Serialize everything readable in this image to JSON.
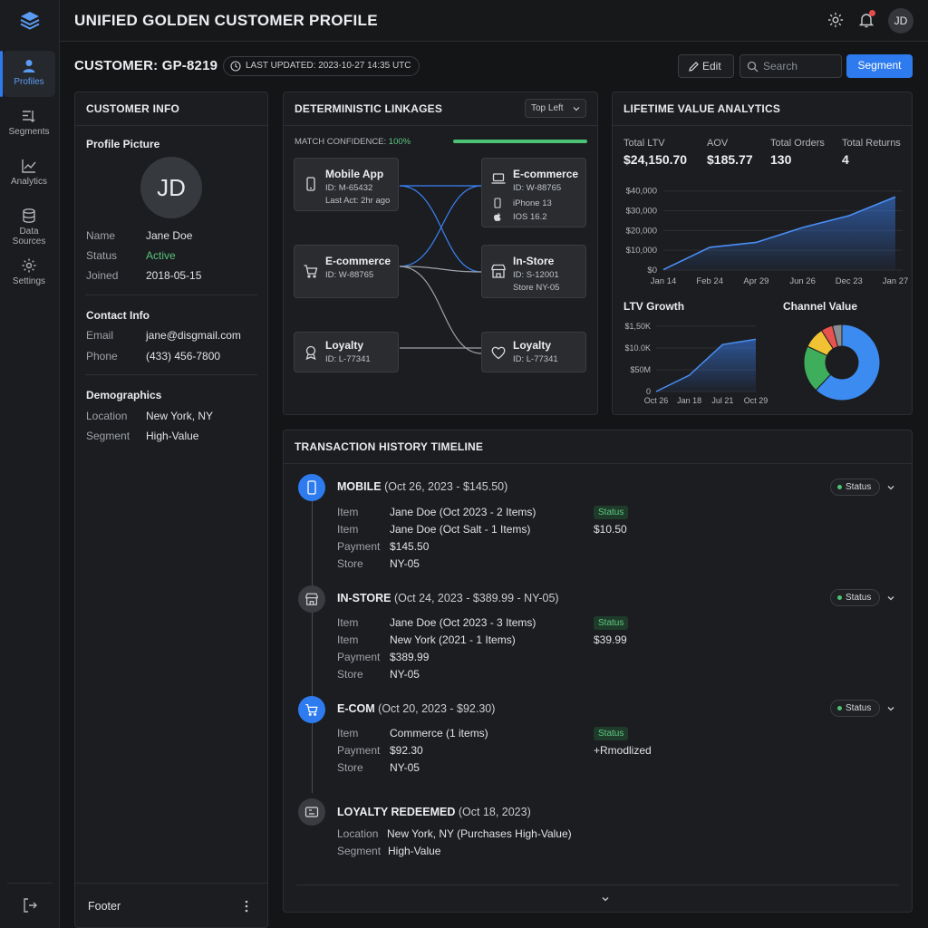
{
  "app": {
    "title": "UNIFIED GOLDEN CUSTOMER PROFILE",
    "user_initials": "JD"
  },
  "sidebar": {
    "items": [
      {
        "label": "Profiles",
        "icon": "person-icon",
        "active": true
      },
      {
        "label": "Segments",
        "icon": "filter-list-icon",
        "active": false
      },
      {
        "label": "Analytics",
        "icon": "line-chart-icon",
        "active": false
      },
      {
        "label": "Data Sources",
        "icon": "database-icon",
        "active": false
      },
      {
        "label": "Settings",
        "icon": "gear-icon",
        "active": false
      }
    ]
  },
  "toolbar": {
    "customer_id": "CUSTOMER: GP-8219",
    "last_updated": "LAST UPDATED: 2023-10-27 14:35 UTC",
    "edit_label": "Edit",
    "search_placeholder": "Search",
    "segment_label": "Segment"
  },
  "customer_info": {
    "title": "CUSTOMER INFO",
    "profile_picture_label": "Profile Picture",
    "initials": "JD",
    "basic": [
      {
        "label": "Name",
        "value": "Jane Doe"
      },
      {
        "label": "Status",
        "value": "Active"
      },
      {
        "label": "Joined",
        "value": "2018-05-15"
      }
    ],
    "contact_title": "Contact Info",
    "contact": [
      {
        "label": "Email",
        "value": "jane@disgmail.com"
      },
      {
        "label": "Phone",
        "value": "(433) 456-7800"
      }
    ],
    "demographics_title": "Demographics",
    "demographics": [
      {
        "label": "Location",
        "value": "New York, NY"
      },
      {
        "label": "Segment",
        "value": "High-Value"
      }
    ],
    "footer_label": "Footer"
  },
  "linkages": {
    "title": "DETERMINISTIC LINKAGES",
    "dropdown": "Top Left",
    "match_label": "MATCH CONFIDENCE:",
    "match_value": "100%",
    "match_fraction": 1.0,
    "left_nodes": [
      {
        "title": "Mobile App",
        "line1": "ID: M-65432",
        "line2": "Last Act: 2hr ago",
        "icon": "phone-icon"
      },
      {
        "title": "E-commerce",
        "line1": "ID: W-88765",
        "line2": "",
        "icon": "cart-icon"
      },
      {
        "title": "Loyalty",
        "line1": "ID: L-77341",
        "line2": "",
        "icon": "award-icon"
      }
    ],
    "right_nodes": [
      {
        "title": "E-commerce",
        "line1": "ID: W-88765",
        "line2": "iPhone 13",
        "line3": "IOS 16.2",
        "icon": "laptop-icon"
      },
      {
        "title": "In-Store",
        "line1": "ID: S-12001",
        "line2": "Store NY-05",
        "icon": "store-icon"
      },
      {
        "title": "Loyalty",
        "line1": "ID: L-77341",
        "line2": "",
        "icon": "heart-icon"
      }
    ]
  },
  "ltv": {
    "title": "LIFETIME VALUE ANALYTICS",
    "kpis": [
      {
        "label": "Total LTV",
        "value": "$24,150.70"
      },
      {
        "label": "AOV",
        "value": "$185.77"
      },
      {
        "label": "Total Orders",
        "value": "130"
      },
      {
        "label": "Total Returns",
        "value": "4"
      }
    ],
    "growth_title": "LTV Growth",
    "channel_title": "Channel Value"
  },
  "chart_data": [
    {
      "type": "area",
      "categories": [
        "Jan 14",
        "Feb 24",
        "Apr 29",
        "Jun 26",
        "Dec 23",
        "Jan 27"
      ],
      "yticks": [
        "$0",
        "$10,000",
        "$20,000",
        "$30,000",
        "$40,000"
      ],
      "ylim": [
        0,
        44000
      ],
      "values": [
        200,
        11500,
        14000,
        21500,
        27500,
        37000
      ],
      "color": "#3b82f6"
    },
    {
      "type": "area",
      "categories": [
        "Oct 26",
        "Jan 18",
        "Jul 21",
        "Oct 29"
      ],
      "yticks": [
        "0",
        "$50M",
        "$10.0K",
        "$1,50K"
      ],
      "values": [
        0,
        0.25,
        0.72,
        0.8
      ],
      "color": "#3b82f6"
    },
    {
      "type": "pie",
      "slices": [
        {
          "value": 0.62,
          "color": "#3b8bf0"
        },
        {
          "value": 0.2,
          "color": "#3fae5c"
        },
        {
          "value": 0.09,
          "color": "#f0c234"
        },
        {
          "value": 0.05,
          "color": "#e8524f"
        },
        {
          "value": 0.04,
          "color": "#8a8d92"
        }
      ]
    }
  ],
  "transactions": {
    "title": "TRANSACTION HISTORY TIMELINE",
    "status_label": "Status",
    "entries": [
      {
        "channel": "MOBILE",
        "summary": "(Oct 26, 2023 - $145.50)",
        "color": "#2d7bef",
        "icon": "phone-icon",
        "rows": [
          {
            "label": "Item",
            "value": "Jane Doe (Oct 2023 - 2 Items)",
            "side": "Status",
            "side_type": "badge"
          },
          {
            "label": "Item",
            "value": "Jane Doe (Oct Salt - 1 Items)",
            "side": "$10.50",
            "side_type": "text"
          },
          {
            "label": "Payment",
            "value": "$145.50"
          },
          {
            "label": "Store",
            "value": "NY-05"
          }
        ]
      },
      {
        "channel": "IN-STORE",
        "summary": "(Oct 24, 2023 - $389.99 - NY-05)",
        "color": "#3a3c41",
        "icon": "store-icon",
        "rows": [
          {
            "label": "Item",
            "value": "Jane Doe (Oct 2023 - 3 Items)",
            "side": "Status",
            "side_type": "badge"
          },
          {
            "label": "Item",
            "value": "New York (2021 - 1 Items)",
            "side": "$39.99",
            "side_type": "text"
          },
          {
            "label": "Payment",
            "value": "$389.99"
          },
          {
            "label": "Store",
            "value": "NY-05"
          }
        ]
      },
      {
        "channel": "E-COM",
        "summary": "(Oct 20, 2023 - $92.30)",
        "color": "#2d7bef",
        "icon": "cart-icon",
        "rows": [
          {
            "label": "Item",
            "value": "Commerce (1 items)",
            "side": "Status",
            "side_type": "badge"
          },
          {
            "label": "Payment",
            "value": "$92.30",
            "side": "+Rmodlized",
            "side_type": "text"
          },
          {
            "label": "Store",
            "value": "NY-05"
          }
        ]
      },
      {
        "channel": "LOYALTY REDEEMED",
        "summary": "(Oct 18, 2023)",
        "color": "#3a3c41",
        "icon": "ticket-icon",
        "rows": [
          {
            "label": "Location",
            "value": "New York, NY (Purchases High-Value)"
          },
          {
            "label": "Segment",
            "value": "High-Value"
          }
        ]
      }
    ]
  }
}
